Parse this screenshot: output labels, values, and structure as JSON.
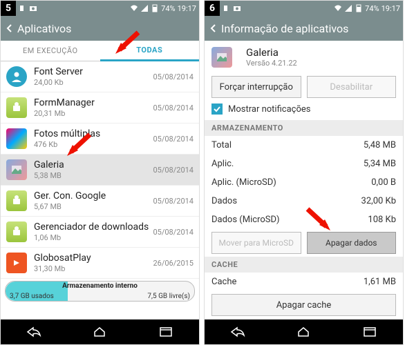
{
  "status": {
    "battery": "74%",
    "time": "19:17"
  },
  "left": {
    "step": "5",
    "title": "Aplicativos",
    "tabs": {
      "running": "EM EXECUÇÃO",
      "all": "TODAS"
    },
    "apps": [
      {
        "name": "Font Server",
        "size": "24,00 Kb",
        "date": "05/08/2014",
        "icon": "user"
      },
      {
        "name": "FormManager",
        "size": "20,31 Mb",
        "date": "05/08/2014",
        "icon": "android"
      },
      {
        "name": "Fotos múltiplas",
        "size": "476 Kb",
        "date": "05/08/2014",
        "icon": "photos"
      },
      {
        "name": "Galeria",
        "size": "5,38 MB",
        "date": "05/08/2014",
        "icon": "gallery",
        "selected": true
      },
      {
        "name": "Ger. Con. Google",
        "size": "5,67 MB",
        "date": "05/08/2014",
        "icon": "android"
      },
      {
        "name": "Gerenciador de downloads",
        "size": "1,06 Mb",
        "date": "05/08/2014",
        "icon": "android"
      },
      {
        "name": "GlobosatPlay",
        "size": "31,30 Mb",
        "date": "26/06/2015",
        "icon": "globo"
      }
    ],
    "storage": {
      "title": "Armazenamento interno",
      "used": "3,7 GB usados",
      "free": "7,5 GB livre(s)"
    }
  },
  "right": {
    "step": "6",
    "title": "Informação de aplicativos",
    "app": {
      "name": "Galeria",
      "version": "Versão 4.21.22"
    },
    "buttons": {
      "force_stop": "Forçar interrupção",
      "disable": "Desabilitar"
    },
    "notify": "Mostrar notificações",
    "sections": {
      "storage": "ARMAZENAMENTO",
      "cache": "CACHE"
    },
    "storage": [
      {
        "k": "Total",
        "v": "5,48 MB"
      },
      {
        "k": "Aplic.",
        "v": "5,34 MB"
      },
      {
        "k": "Aplic. (MicroSD)",
        "v": "0,00 B"
      },
      {
        "k": "Dados",
        "v": "32,00 Kb"
      },
      {
        "k": "Dados (MicroSD)",
        "v": "108 Kb"
      }
    ],
    "storage_buttons": {
      "move": "Mover para MicroSD",
      "clear_data": "Apagar dados"
    },
    "cache": {
      "k": "Cache",
      "v": "1,61 MB"
    },
    "clear_cache": "Apagar cache"
  }
}
